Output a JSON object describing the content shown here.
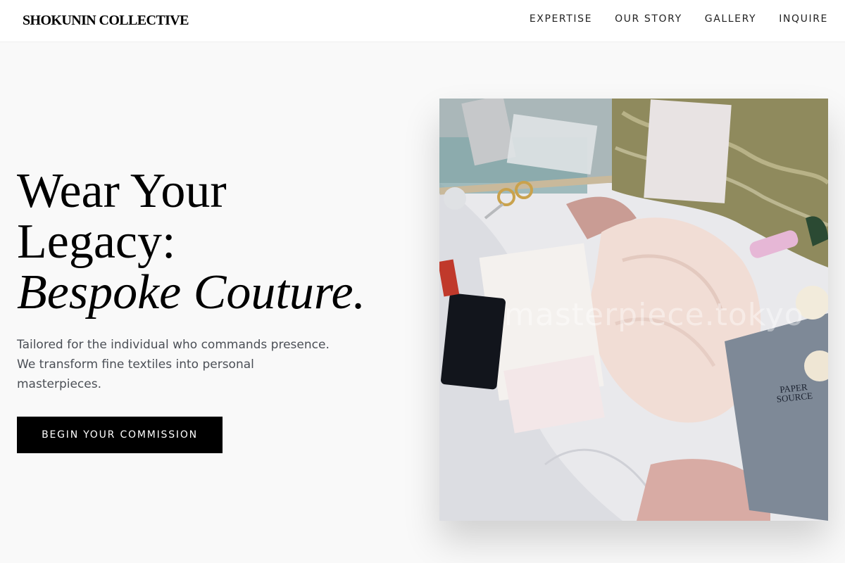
{
  "header": {
    "brand": "SHOKUNIN COLLECTIVE",
    "nav": [
      "EXPERTISE",
      "OUR STORY",
      "GALLERY",
      "INQUIRE"
    ]
  },
  "hero": {
    "headline_line1": "Wear Your",
    "headline_line2": "Legacy:",
    "headline_line3": "Bespoke Couture.",
    "tagline_line1": "Tailored for the individual who commands presence.",
    "tagline_line2": "We transform fine textiles into personal",
    "tagline_line3": "masterpieces.",
    "cta_label": "BEGIN YOUR COMMISSION"
  },
  "photo": {
    "watermark": "masterpiece.tokyo",
    "paper_line1": "PAPER",
    "paper_line2": "SOURCE"
  },
  "colors": {
    "page_bg": "#f9f9f9",
    "header_bg": "#ffffff",
    "text": "#000000",
    "muted_text": "#4b4f56",
    "cta_bg": "#000000",
    "cta_text": "#ffffff"
  }
}
